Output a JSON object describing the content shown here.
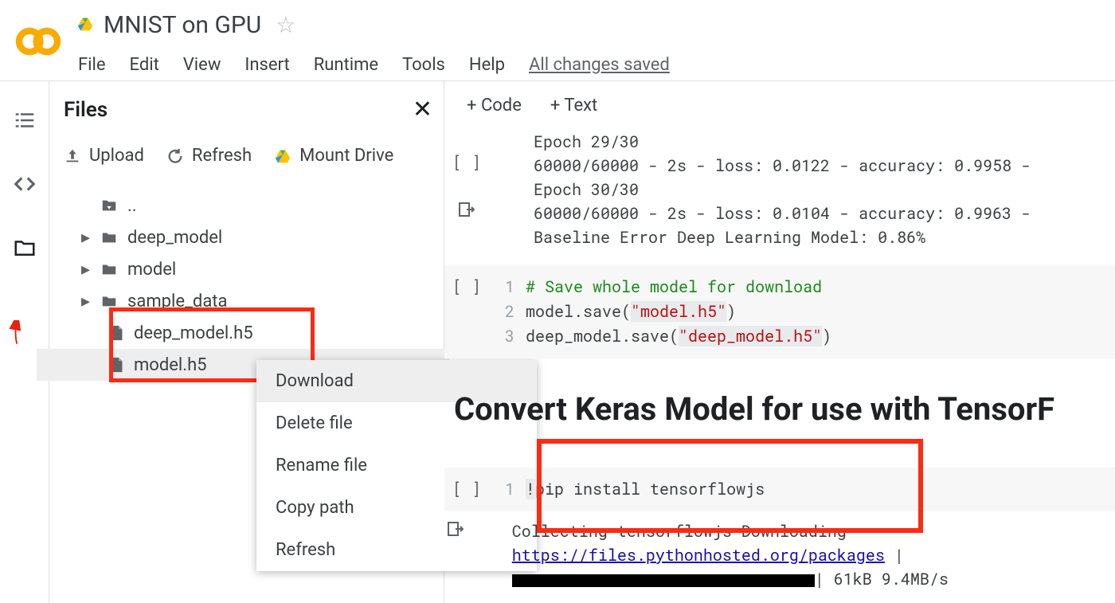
{
  "header": {
    "notebook_title": "MNIST on GPU",
    "menu": {
      "file": "File",
      "edit": "Edit",
      "view": "View",
      "insert": "Insert",
      "runtime": "Runtime",
      "tools": "Tools",
      "help": "Help",
      "saved": "All changes saved"
    }
  },
  "panel": {
    "title": "Files",
    "actions": {
      "upload": "Upload",
      "refresh": "Refresh",
      "mount": "Mount Drive"
    },
    "tree": {
      "parent": "..",
      "folders": [
        "deep_model",
        "model",
        "sample_data"
      ],
      "files": [
        "deep_model.h5",
        "model.h5"
      ]
    }
  },
  "context_menu": {
    "download": "Download",
    "delete": "Delete file",
    "rename": "Rename file",
    "copypath": "Copy path",
    "refresh": "Refresh"
  },
  "toolbar": {
    "code": "+ Code",
    "text": "+ Text"
  },
  "output1": {
    "l1": "Epoch 29/30",
    "l2": "60000/60000 - 2s - loss: 0.0122 - accuracy: 0.9958 -",
    "l3": "Epoch 30/30",
    "l4": "60000/60000 - 2s - loss: 0.0104 - accuracy: 0.9963 -",
    "l5": "Baseline Error Deep Learning Model: 0.86%"
  },
  "code1": {
    "ln1": "1",
    "ln2": "2",
    "ln3": "3",
    "c1_comment": "# Save whole model for download",
    "c2_a": "model.save(",
    "c2_str": "\"model.h5\"",
    "c2_b": ")",
    "c3_a": "deep_model.save(",
    "c3_str": "\"deep_model.h5\"",
    "c3_b": ")"
  },
  "section_heading": "Convert Keras Model for use with TensorF",
  "code2": {
    "ln1": "1",
    "bang": "!",
    "text": "pip install tensorflowjs"
  },
  "output2": {
    "l1": "Collecting tensorflowjs",
    "l2_a": "  Downloading ",
    "l2_link": "https://files.pythonhosted.org/packages",
    "l3_pre": "    |",
    "l3_post": "| 61kB 9.4MB/s"
  },
  "brackets": "[ ]"
}
